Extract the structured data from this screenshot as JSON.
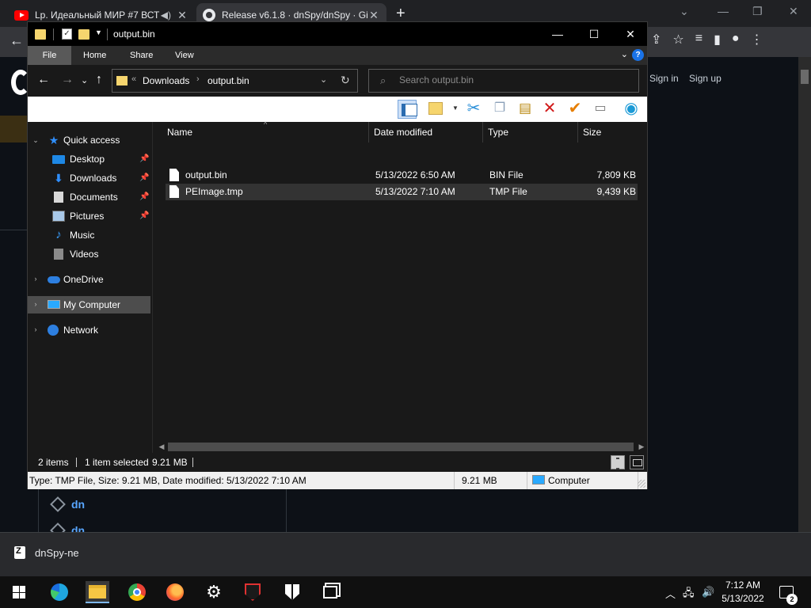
{
  "browser": {
    "tabs": [
      {
        "title": "Lp. Идеальный МИР #7 ВСТ",
        "icon": "youtube-icon",
        "audio": true
      },
      {
        "title": "Release v6.1.8 · dnSpy/dnSpy · Gi",
        "icon": "github-icon",
        "active": true
      }
    ],
    "new_tab": "+",
    "background_signin": [
      "Sign in",
      "Sign up"
    ],
    "background_items": [
      "dn",
      "dn"
    ],
    "download_bar": {
      "file": "dnSpy-ne"
    }
  },
  "explorer": {
    "title": "output.bin",
    "window_buttons": {
      "minimize": "—",
      "maximize": "☐",
      "close": "✕"
    },
    "ribbon_tabs": [
      "File",
      "Home",
      "Share",
      "View"
    ],
    "address": {
      "crumbs": [
        "Downloads",
        "output.bin"
      ],
      "prefix": "«"
    },
    "search_placeholder": "Search output.bin",
    "nav_pane": [
      {
        "label": "Quick access",
        "icon": "star-icon",
        "expander": "open",
        "pinned": false
      },
      {
        "label": "Desktop",
        "icon": "desktop-icon",
        "pinned": true
      },
      {
        "label": "Downloads",
        "icon": "download-icon",
        "pinned": true
      },
      {
        "label": "Documents",
        "icon": "documents-icon",
        "pinned": true
      },
      {
        "label": "Pictures",
        "icon": "pictures-icon",
        "pinned": true
      },
      {
        "label": "Music",
        "icon": "music-icon",
        "pinned": false
      },
      {
        "label": "Videos",
        "icon": "videos-icon",
        "pinned": false
      },
      {
        "label": "OneDrive",
        "icon": "onedrive-icon",
        "expander": "closed"
      },
      {
        "label": "My Computer",
        "icon": "computer-icon",
        "expander": "closed",
        "selected": true
      },
      {
        "label": "Network",
        "icon": "network-icon",
        "expander": "closed"
      }
    ],
    "columns": [
      "Name",
      "Date modified",
      "Type",
      "Size"
    ],
    "files": [
      {
        "name": "output.bin",
        "date": "5/13/2022 6:50 AM",
        "type": "BIN File",
        "size": "7,809 KB",
        "selected": false
      },
      {
        "name": "PEImage.tmp",
        "date": "5/13/2022 7:10 AM",
        "type": "TMP File",
        "size": "9,439 KB",
        "selected": true
      }
    ],
    "status": {
      "count": "2 items",
      "selection": "1 item selected",
      "selection_size": "9.21 MB"
    },
    "info_bar": {
      "details": "Type: TMP File, Size: 9.21 MB, Date modified: 5/13/2022 7:10 AM",
      "size": "9.21 MB",
      "location": "Computer"
    }
  },
  "taskbar": {
    "apps": [
      "start-icon",
      "edge-icon",
      "file-explorer-icon",
      "chrome-icon",
      "firefox-icon",
      "settings-icon",
      "vpn-icon",
      "security-shield-icon",
      "task-switch-icon"
    ],
    "clock": {
      "time": "7:12 AM",
      "date": "5/13/2022"
    },
    "notifications": "2"
  },
  "colors": {
    "explorer_bg": "#191919",
    "title_bg": "#000000",
    "selection": "#333333",
    "accent": "#1a73e8"
  }
}
